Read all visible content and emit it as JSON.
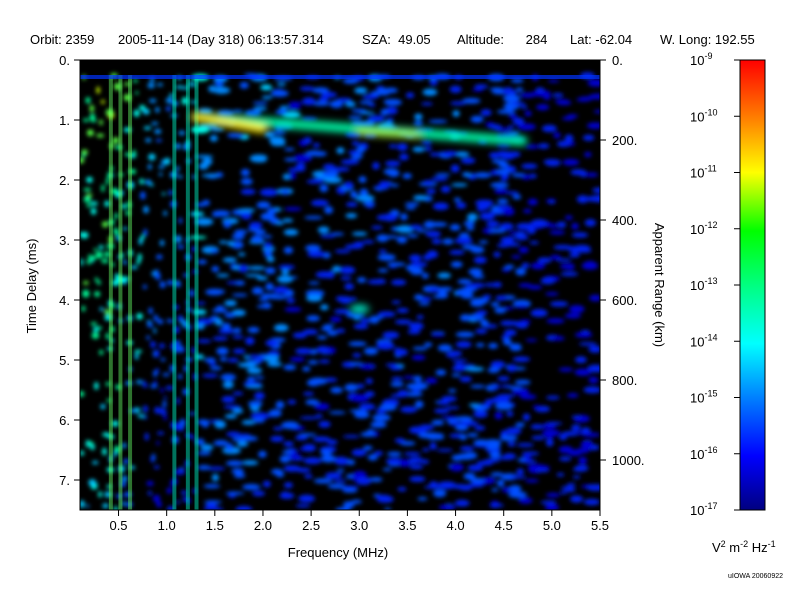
{
  "header": {
    "orbit": "Orbit: 2359",
    "datetime": "2005-11-14 (Day 318) 06:13:57.314",
    "sza": "SZA:  49.05",
    "altitude": "Altitude:      284",
    "lat": "Lat: -62.04",
    "wlong": "W. Long: 192.55"
  },
  "chart_data": {
    "type": "heatmap",
    "xlabel": "Frequency (MHz)",
    "ylabel": "Time Delay (ms)",
    "y2label": "Apparent Range (km)",
    "xlim": [
      0.1,
      5.5
    ],
    "ylim": [
      0,
      7.5
    ],
    "y2lim": [
      0,
      1125
    ],
    "x_ticks": [
      "0.5",
      "1.0",
      "1.5",
      "2.0",
      "2.5",
      "3.0",
      "3.5",
      "4.0",
      "4.5",
      "5.0",
      "5.5"
    ],
    "y_ticks": [
      "0.",
      "1.",
      "2.",
      "3.",
      "4.",
      "5.",
      "6.",
      "7."
    ],
    "y2_ticks": [
      "0.",
      "200.",
      "400.",
      "600.",
      "800.",
      "1000."
    ],
    "colorbar": {
      "scale": "log",
      "range": [
        1e-17,
        1e-09
      ],
      "ticks": [
        {
          "base": "10",
          "exp": "-9"
        },
        {
          "base": "10",
          "exp": "-10"
        },
        {
          "base": "10",
          "exp": "-11"
        },
        {
          "base": "10",
          "exp": "-12"
        },
        {
          "base": "10",
          "exp": "-13"
        },
        {
          "base": "10",
          "exp": "-14"
        },
        {
          "base": "10",
          "exp": "-15"
        },
        {
          "base": "10",
          "exp": "-16"
        },
        {
          "base": "10",
          "exp": "-17"
        }
      ],
      "unit_parts": [
        "V",
        "2",
        " m",
        "-2",
        " Hz",
        "-1"
      ]
    },
    "features": [
      {
        "kind": "ground-echo",
        "freq_start": 1.3,
        "freq_end": 4.7,
        "delay_start": 0.95,
        "delay_end": 1.35
      }
    ]
  },
  "credit": "uIOWA 20060922",
  "colors": {
    "background_low": "#000080",
    "noise": "#0033dd",
    "echo": "#00ffbb",
    "strong": "#ffee00"
  }
}
